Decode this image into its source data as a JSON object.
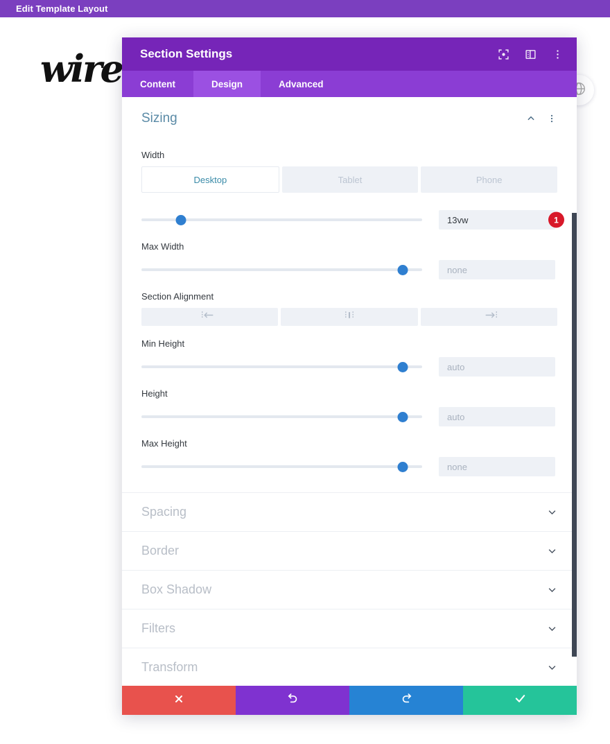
{
  "top_bar": {
    "title": "Edit Template Layout",
    "background": "#7b3fbf"
  },
  "canvas": {
    "logo_text": "wire",
    "globe_icon": "globe-icon"
  },
  "modal": {
    "title": "Section Settings",
    "header_background": "#7625b8",
    "header_icons": [
      {
        "name": "focus-frame-icon",
        "label": "Focus"
      },
      {
        "name": "panel-layout-icon",
        "label": "Layout"
      },
      {
        "name": "more-vertical-icon",
        "label": "More"
      }
    ],
    "tabs": [
      {
        "label": "Content",
        "active": false
      },
      {
        "label": "Design",
        "active": true
      },
      {
        "label": "Advanced",
        "active": false
      }
    ],
    "open_section": {
      "title": "Sizing",
      "title_color": "#5a8aa6",
      "collapse_icon": "chevron-up-icon",
      "options_icon": "more-vertical-icon",
      "fields": [
        {
          "label": "Width",
          "device_tabs": [
            {
              "label": "Desktop",
              "active": true
            },
            {
              "label": "Tablet",
              "active": false
            },
            {
              "label": "Phone",
              "active": false
            }
          ],
          "slider_percent": 14,
          "value": "13vw",
          "value_is_placeholder": false,
          "badge": "1"
        },
        {
          "label": "Max Width",
          "slider_percent": 98,
          "value": "none",
          "value_is_placeholder": true
        },
        {
          "label": "Section Alignment",
          "align_buttons": [
            {
              "name": "align-left-icon"
            },
            {
              "name": "align-center-icon"
            },
            {
              "name": "align-right-icon"
            }
          ]
        },
        {
          "label": "Min Height",
          "slider_percent": 98,
          "value": "auto",
          "value_is_placeholder": true
        },
        {
          "label": "Height",
          "slider_percent": 98,
          "value": "auto",
          "value_is_placeholder": true
        },
        {
          "label": "Max Height",
          "slider_percent": 98,
          "value": "none",
          "value_is_placeholder": true
        }
      ]
    },
    "collapsed_sections": [
      {
        "label": "Spacing"
      },
      {
        "label": "Border"
      },
      {
        "label": "Box Shadow"
      },
      {
        "label": "Filters"
      },
      {
        "label": "Transform"
      }
    ],
    "footer_buttons": [
      {
        "name": "cancel-button",
        "icon": "close-icon",
        "color": "#e8524d"
      },
      {
        "name": "undo-button",
        "icon": "undo-icon",
        "color": "#7f32d0"
      },
      {
        "name": "redo-button",
        "icon": "redo-icon",
        "color": "#2683d4"
      },
      {
        "name": "save-button",
        "icon": "check-icon",
        "color": "#25c49a"
      }
    ]
  }
}
